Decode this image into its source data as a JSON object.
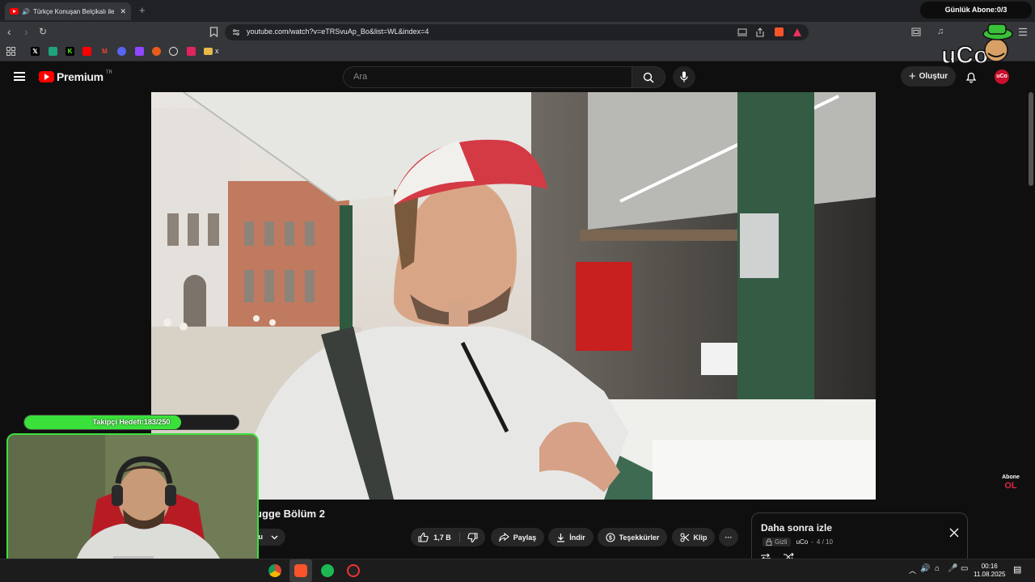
{
  "browser": {
    "tab_title": "Türkçe Konuşan Belçikalı ile B",
    "new_tab": "+",
    "url": "youtube.com/watch?v=eTRSvuAp_Bo&list=WL&index=4"
  },
  "overlay": {
    "sub_counter": "Günlük Abone:0/3",
    "follow_goal": "Takipçi Hedefi:183/250",
    "follow_progress": 0.732,
    "abone_line1": "Abone",
    "abone_line2": "OL"
  },
  "youtube": {
    "brand": "Premium",
    "region": "TR",
    "search_placeholder": "Ara",
    "create_label": "Oluştur",
    "avatar_text": "uCo",
    "video_title_visible": "ugge Bölüm 2",
    "subscribe_partial": "lu",
    "actions": {
      "likes": "1,7 B",
      "share": "Paylaş",
      "download": "İndir",
      "thanks": "Teşekkürler",
      "clip": "Klip",
      "more": "···"
    },
    "watch_later": {
      "title": "Daha sonra izle",
      "privacy": "Gizli",
      "owner": "uCo",
      "position": "4 / 10"
    }
  },
  "bookmarks": {
    "folder_label": "x"
  },
  "taskbar": {
    "time": "00:16",
    "date": "11.08.2025"
  },
  "colors": {
    "youtube_red": "#ff0000",
    "overlay_green": "#3be13b"
  }
}
